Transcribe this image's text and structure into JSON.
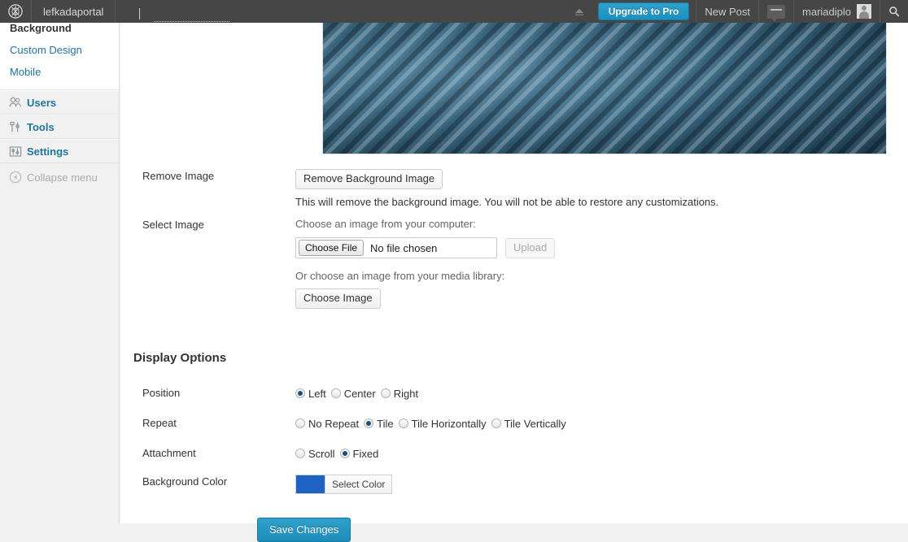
{
  "adminbar": {
    "logo_icon": "wordpress-logo-icon",
    "site_name": "lefkadaportal",
    "upgrade_label": "Upgrade to Pro",
    "new_post_label": "New Post",
    "comments_icon": "comment-bubble-icon",
    "user_name": "mariadiplo",
    "avatar_icon": "avatar-icon",
    "search_icon": "search-icon",
    "collapse_arrow_icon": "collapse-up-arrow-icon",
    "bg_color": "#464646"
  },
  "sidebar": {
    "submenu": [
      {
        "label": "Background",
        "current": true
      },
      {
        "label": "Custom Design",
        "current": false
      },
      {
        "label": "Mobile",
        "current": false
      }
    ],
    "menu": [
      {
        "label": "Users",
        "icon": "users-icon"
      },
      {
        "label": "Tools",
        "icon": "tools-icon"
      },
      {
        "label": "Settings",
        "icon": "settings-icon"
      }
    ],
    "collapse": {
      "label": "Collapse menu",
      "icon": "collapse-left-icon"
    },
    "link_color": "#21759b"
  },
  "main": {
    "preview": {
      "alt": "background-image-preview"
    },
    "remove_image": {
      "label": "Remove Image",
      "button": "Remove Background Image",
      "description": "This will remove the background image. You will not be able to restore any customizations."
    },
    "select_image": {
      "label": "Select Image",
      "computer_prompt": "Choose an image from your computer:",
      "file_button": "Choose File",
      "file_name": "No file chosen",
      "upload_button": "Upload",
      "library_prompt": "Or choose an image from your media library:",
      "choose_image_button": "Choose Image"
    },
    "display_options": {
      "title": "Display Options",
      "position": {
        "label": "Position",
        "options": [
          {
            "label": "Left",
            "selected": true
          },
          {
            "label": "Center",
            "selected": false
          },
          {
            "label": "Right",
            "selected": false
          }
        ]
      },
      "repeat": {
        "label": "Repeat",
        "options": [
          {
            "label": "No Repeat",
            "selected": false
          },
          {
            "label": "Tile",
            "selected": true
          },
          {
            "label": "Tile Horizontally",
            "selected": false
          },
          {
            "label": "Tile Vertically",
            "selected": false
          }
        ]
      },
      "attachment": {
        "label": "Attachment",
        "options": [
          {
            "label": "Scroll",
            "selected": false
          },
          {
            "label": "Fixed",
            "selected": true
          }
        ]
      },
      "background_color": {
        "label": "Background Color",
        "swatch_color": "#1e62c4",
        "button": "Select Color"
      }
    },
    "save_button": "Save Changes"
  }
}
